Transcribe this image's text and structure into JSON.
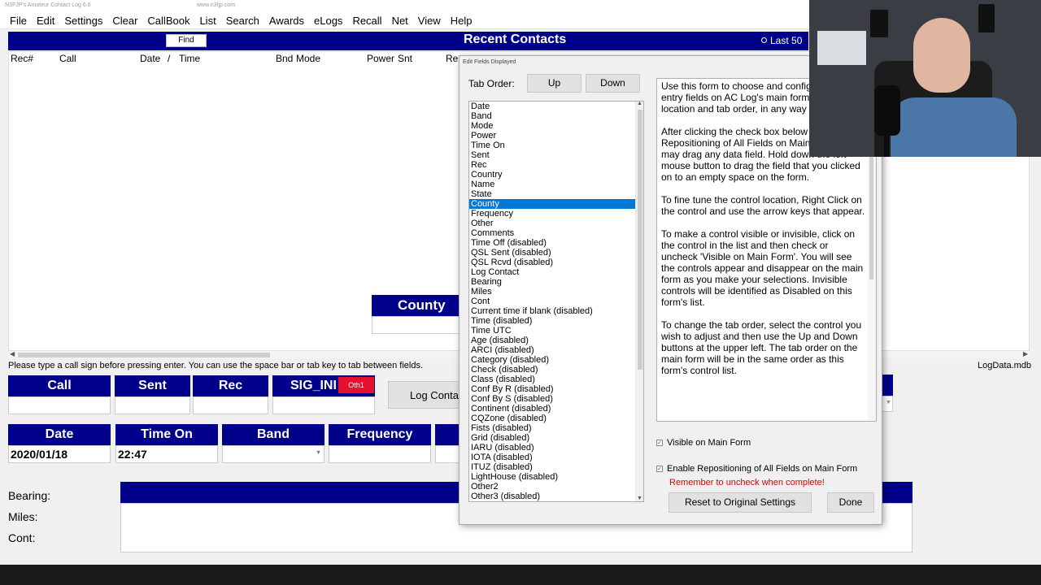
{
  "app": {
    "window_title": "N3FJP's Amateur Contact Log 6.6",
    "url_text": "www.n3fjp.com"
  },
  "menu": [
    "File",
    "Edit",
    "Settings",
    "Clear",
    "CallBook",
    "List",
    "Search",
    "Awards",
    "eLogs",
    "Recall",
    "Net",
    "View",
    "Help"
  ],
  "header": {
    "find_label": "Find",
    "title": "Recent Contacts",
    "last50_label": "Last 50"
  },
  "columns": [
    "Rec#",
    "Call",
    "Date",
    "/",
    "Time",
    "Bnd",
    "Mode",
    "Power",
    "Snt",
    "Re"
  ],
  "county_float": {
    "label": "County"
  },
  "hint_text": "Please type a call sign before pressing enter.  You can use the space bar or tab key to tab between fields.",
  "logdata_text": "LogData.mdb",
  "row1": {
    "call_label": "Call",
    "sent_label": "Sent",
    "rec_label": "Rec",
    "sig_label": "SIG_INI",
    "oth1_label": "Oth1",
    "log_contact_label": "Log Conta"
  },
  "row2": {
    "date_label": "Date",
    "date_value": "2020/01/18",
    "time_on_label": "Time On",
    "time_on_value": "22:47",
    "band_label": "Band",
    "frequency_label": "Frequency"
  },
  "side_labels": {
    "bearing": "Bearing:",
    "miles": "Miles:",
    "cont": "Cont:"
  },
  "dialog": {
    "title": "Edit Fields Displayed",
    "tab_order_label": "Tab Order:",
    "up_label": "Up",
    "down_label": "Down",
    "fields": [
      "Date",
      "Band",
      "Mode",
      "Power",
      "Time On",
      "Sent",
      "Rec",
      "Country",
      "Name",
      "State",
      "County",
      "Frequency",
      "Other",
      "Comments",
      "Time Off (disabled)",
      "QSL Sent (disabled)",
      "QSL Rcvd (disabled)",
      "Log Contact",
      "Bearing",
      "Miles",
      "Cont",
      "Current time if blank (disabled)",
      "Time (disabled)",
      "Time UTC",
      "Age (disabled)",
      "ARCI (disabled)",
      "Category (disabled)",
      "Check (disabled)",
      "Class (disabled)",
      "Conf By R (disabled)",
      "Conf By S (disabled)",
      "Continent (disabled)",
      "CQZone (disabled)",
      "Fists (disabled)",
      "Grid (disabled)",
      "IARU (disabled)",
      "IOTA (disabled)",
      "ITUZ (disabled)",
      "LightHouse (disabled)",
      "Other2",
      "Other3 (disabled)"
    ],
    "selected_field": "County",
    "help_paragraphs": [
      "Use this form to choose and configure the data entry fields on AC Log's main form, their location and tab order, in any way you like!",
      "After clicking the check box below 'Enable Repositioning of All Fields on Main Form', you may drag any data field.  Hold down the left mouse button to drag the field that you clicked on to an empty space on the form.",
      "To fine tune the control location, Right Click on the control and use the arrow keys that appear.",
      "To make a control visible or invisible, click on the control in the list and then check or uncheck 'Visible on Main Form'.  You will see the controls appear and disappear on the main form as you make your selections.  Invisible controls will be identified as Disabled on this form's list.",
      "To change the tab order, select the control you wish to adjust and then use the Up and Down buttons at the upper left.  The tab order on the main form will be in the same order as this form's control list."
    ],
    "visible_label": "Visible on Main Form",
    "visible_checked": true,
    "reposition_label": "Enable Repositioning of All Fields on Main Form",
    "reposition_checked": true,
    "remember_text": "Remember to uncheck when complete!",
    "reset_label": "Reset to Original Settings",
    "done_label": "Done"
  },
  "colors": {
    "header_blue": "#00008b",
    "selection_blue": "#0078d7",
    "oth1_red": "#e8112d",
    "warning_red": "#e00000"
  }
}
